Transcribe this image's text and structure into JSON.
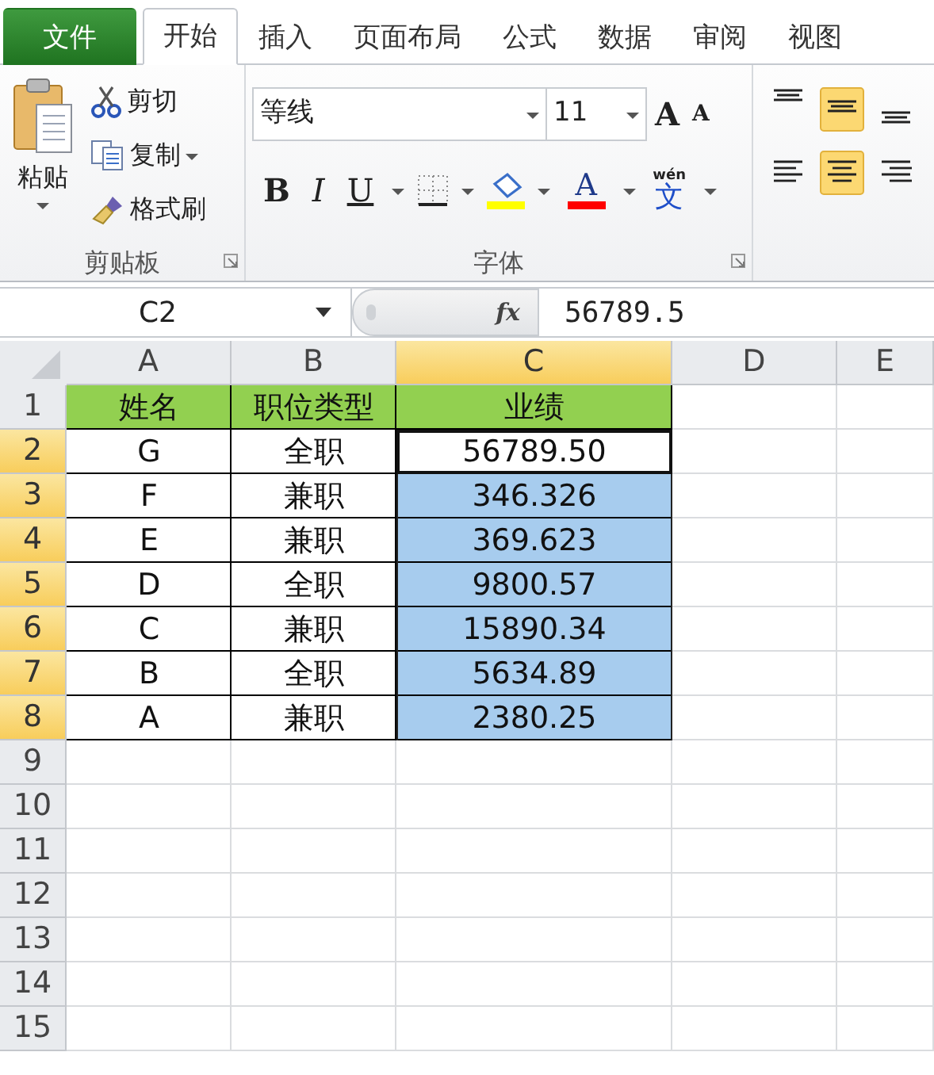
{
  "tabs": [
    {
      "label": "文件",
      "kind": "file",
      "selected": false
    },
    {
      "label": "开始",
      "kind": "tab",
      "selected": true
    },
    {
      "label": "插入",
      "kind": "tab",
      "selected": false
    },
    {
      "label": "页面布局",
      "kind": "tab",
      "selected": false
    },
    {
      "label": "公式",
      "kind": "tab",
      "selected": false
    },
    {
      "label": "数据",
      "kind": "tab",
      "selected": false
    },
    {
      "label": "审阅",
      "kind": "tab",
      "selected": false
    },
    {
      "label": "视图",
      "kind": "tab",
      "selected": false
    }
  ],
  "clipboard": {
    "paste": "粘贴",
    "cut": "剪切",
    "copy": "复制",
    "format_painter": "格式刷",
    "group_label": "剪贴板"
  },
  "font": {
    "name": "等线",
    "size": "11",
    "grow": "A",
    "shrink": "A",
    "bold": "B",
    "italic": "I",
    "underline": "U",
    "font_color": "A",
    "phonetic_top": "wén",
    "phonetic": "文",
    "group_label": "字体"
  },
  "alignment": {
    "vertical": [
      {
        "selected": false
      },
      {
        "selected": true
      },
      {
        "selected": false
      }
    ],
    "horizontal": [
      {
        "selected": false
      },
      {
        "selected": true
      },
      {
        "selected": false
      }
    ]
  },
  "formula_bar": {
    "name_box": "C2",
    "fx": "fx",
    "value": "56789.5"
  },
  "sheet": {
    "columns": [
      {
        "label": "A",
        "selected": false
      },
      {
        "label": "B",
        "selected": false
      },
      {
        "label": "C",
        "selected": true
      },
      {
        "label": "D",
        "selected": false
      },
      {
        "label": "E",
        "selected": false
      }
    ],
    "rows": [
      {
        "number": "1",
        "kind": "header",
        "selected": false,
        "active": false,
        "cells": [
          "姓名",
          "职位类型",
          "业绩"
        ]
      },
      {
        "number": "2",
        "kind": "data",
        "selected": true,
        "active": true,
        "cells": [
          "G",
          "全职",
          "56789.50"
        ]
      },
      {
        "number": "3",
        "kind": "data",
        "selected": true,
        "active": false,
        "cells": [
          "F",
          "兼职",
          "346.326"
        ]
      },
      {
        "number": "4",
        "kind": "data",
        "selected": true,
        "active": false,
        "cells": [
          "E",
          "兼职",
          "369.623"
        ]
      },
      {
        "number": "5",
        "kind": "data",
        "selected": true,
        "active": false,
        "cells": [
          "D",
          "全职",
          "9800.57"
        ]
      },
      {
        "number": "6",
        "kind": "data",
        "selected": true,
        "active": false,
        "cells": [
          "C",
          "兼职",
          "15890.34"
        ]
      },
      {
        "number": "7",
        "kind": "data",
        "selected": true,
        "active": false,
        "cells": [
          "B",
          "全职",
          "5634.89"
        ]
      },
      {
        "number": "8",
        "kind": "data",
        "selected": true,
        "active": false,
        "cells": [
          "A",
          "兼职",
          "2380.25"
        ]
      },
      {
        "number": "9",
        "kind": "empty",
        "selected": false,
        "active": false,
        "cells": []
      },
      {
        "number": "10",
        "kind": "empty",
        "selected": false,
        "active": false,
        "cells": []
      },
      {
        "number": "11",
        "kind": "empty",
        "selected": false,
        "active": false,
        "cells": []
      },
      {
        "number": "12",
        "kind": "empty",
        "selected": false,
        "active": false,
        "cells": []
      },
      {
        "number": "13",
        "kind": "empty",
        "selected": false,
        "active": false,
        "cells": []
      },
      {
        "number": "14",
        "kind": "empty",
        "selected": false,
        "active": false,
        "cells": []
      },
      {
        "number": "15",
        "kind": "empty",
        "selected": false,
        "active": false,
        "cells": []
      }
    ]
  }
}
